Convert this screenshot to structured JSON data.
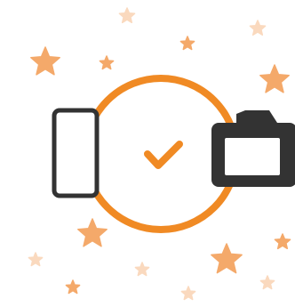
{
  "illustration": {
    "icon_names": [
      "star-icon",
      "phone-icon",
      "checkmark-icon",
      "camera-icon"
    ],
    "colors": {
      "accent": "#F08A24",
      "star_bright": "#F4A96A",
      "star_pale": "#FAD9BE",
      "device_outline": "#333333",
      "device_fill": "#FFFFFF",
      "background": "#FFFFFF"
    }
  }
}
